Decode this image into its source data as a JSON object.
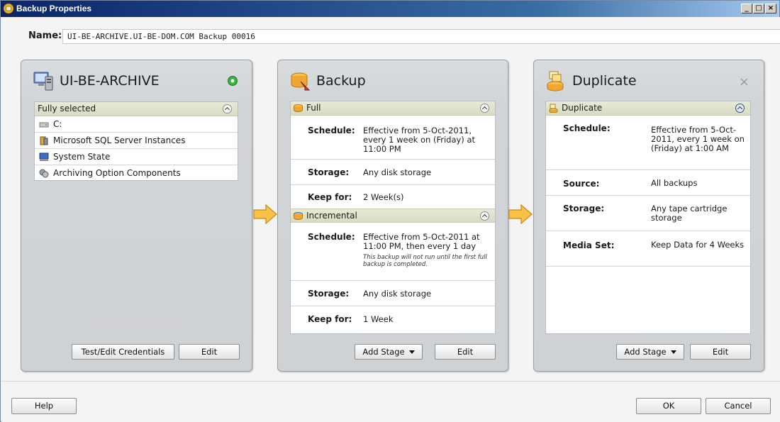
{
  "window": {
    "title": "Backup Properties"
  },
  "name": {
    "label": "Name:",
    "value": "UI-BE-ARCHIVE.UI-BE-DOM.COM Backup 00016"
  },
  "source_panel": {
    "title": "UI-BE-ARCHIVE",
    "status_color": "#3cb043",
    "section_label": "Fully selected",
    "items": [
      {
        "label": "C:",
        "icon": "drive-icon"
      },
      {
        "label": "Microsoft SQL Server Instances",
        "icon": "sql-server-icon"
      },
      {
        "label": "System State",
        "icon": "system-state-icon"
      },
      {
        "label": "Archiving Option Components",
        "icon": "archiving-components-icon"
      }
    ],
    "buttons": {
      "credentials": "Test/Edit Credentials",
      "edit": "Edit"
    }
  },
  "backup_panel": {
    "title": "Backup",
    "full": {
      "label": "Full",
      "schedule_key": "Schedule:",
      "schedule_value": "Effective from 5-Oct-2011, every 1 week on (Friday) at 11:00 PM",
      "storage_key": "Storage:",
      "storage_value": "Any disk storage",
      "keep_key": "Keep for:",
      "keep_value": "2 Week(s)"
    },
    "incremental": {
      "label": "Incremental",
      "schedule_key": "Schedule:",
      "schedule_value": "Effective from 5-Oct-2011 at 11:00 PM, then every 1 day",
      "schedule_note": "This backup will not run until the first full backup is completed.",
      "storage_key": "Storage:",
      "storage_value": "Any disk storage",
      "keep_key": "Keep for:",
      "keep_value": "1 Week"
    },
    "buttons": {
      "add_stage": "Add Stage",
      "edit": "Edit"
    }
  },
  "duplicate_panel": {
    "title": "Duplicate",
    "close": "×",
    "section_label": "Duplicate",
    "schedule_key": "Schedule:",
    "schedule_value": "Effective from 5-Oct-2011, every 1 week on (Friday) at 1:00 AM",
    "source_key": "Source:",
    "source_value": "All backups",
    "storage_key": "Storage:",
    "storage_value": "Any tape cartridge storage",
    "media_key": "Media Set:",
    "media_value": "Keep Data for 4 Weeks",
    "buttons": {
      "add_stage": "Add Stage",
      "edit": "Edit"
    }
  },
  "footer": {
    "help": "Help",
    "ok": "OK",
    "cancel": "Cancel"
  },
  "colors": {
    "arrow": "#f5b43c",
    "titlebar": "#0a246a"
  }
}
